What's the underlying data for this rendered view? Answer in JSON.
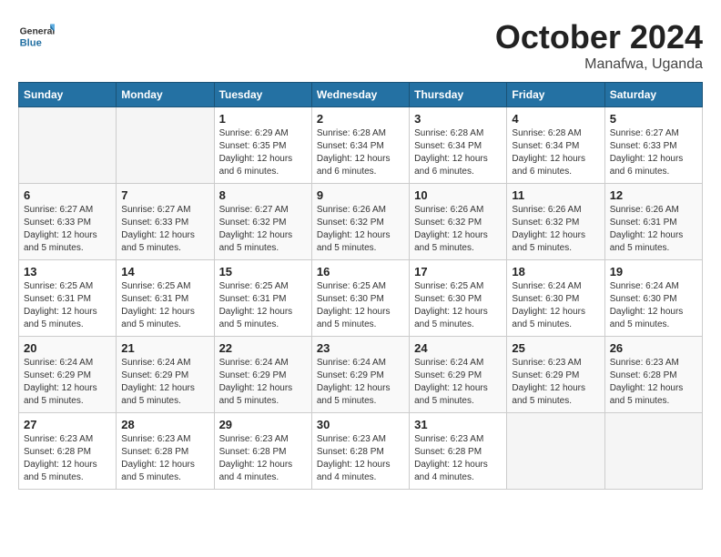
{
  "header": {
    "logo_general": "General",
    "logo_blue": "Blue",
    "month_title": "October 2024",
    "location": "Manafwa, Uganda"
  },
  "days_of_week": [
    "Sunday",
    "Monday",
    "Tuesday",
    "Wednesday",
    "Thursday",
    "Friday",
    "Saturday"
  ],
  "weeks": [
    [
      {
        "day": "",
        "info": ""
      },
      {
        "day": "",
        "info": ""
      },
      {
        "day": "1",
        "info": "Sunrise: 6:29 AM\nSunset: 6:35 PM\nDaylight: 12 hours\nand 6 minutes."
      },
      {
        "day": "2",
        "info": "Sunrise: 6:28 AM\nSunset: 6:34 PM\nDaylight: 12 hours\nand 6 minutes."
      },
      {
        "day": "3",
        "info": "Sunrise: 6:28 AM\nSunset: 6:34 PM\nDaylight: 12 hours\nand 6 minutes."
      },
      {
        "day": "4",
        "info": "Sunrise: 6:28 AM\nSunset: 6:34 PM\nDaylight: 12 hours\nand 6 minutes."
      },
      {
        "day": "5",
        "info": "Sunrise: 6:27 AM\nSunset: 6:33 PM\nDaylight: 12 hours\nand 6 minutes."
      }
    ],
    [
      {
        "day": "6",
        "info": "Sunrise: 6:27 AM\nSunset: 6:33 PM\nDaylight: 12 hours\nand 5 minutes."
      },
      {
        "day": "7",
        "info": "Sunrise: 6:27 AM\nSunset: 6:33 PM\nDaylight: 12 hours\nand 5 minutes."
      },
      {
        "day": "8",
        "info": "Sunrise: 6:27 AM\nSunset: 6:32 PM\nDaylight: 12 hours\nand 5 minutes."
      },
      {
        "day": "9",
        "info": "Sunrise: 6:26 AM\nSunset: 6:32 PM\nDaylight: 12 hours\nand 5 minutes."
      },
      {
        "day": "10",
        "info": "Sunrise: 6:26 AM\nSunset: 6:32 PM\nDaylight: 12 hours\nand 5 minutes."
      },
      {
        "day": "11",
        "info": "Sunrise: 6:26 AM\nSunset: 6:32 PM\nDaylight: 12 hours\nand 5 minutes."
      },
      {
        "day": "12",
        "info": "Sunrise: 6:26 AM\nSunset: 6:31 PM\nDaylight: 12 hours\nand 5 minutes."
      }
    ],
    [
      {
        "day": "13",
        "info": "Sunrise: 6:25 AM\nSunset: 6:31 PM\nDaylight: 12 hours\nand 5 minutes."
      },
      {
        "day": "14",
        "info": "Sunrise: 6:25 AM\nSunset: 6:31 PM\nDaylight: 12 hours\nand 5 minutes."
      },
      {
        "day": "15",
        "info": "Sunrise: 6:25 AM\nSunset: 6:31 PM\nDaylight: 12 hours\nand 5 minutes."
      },
      {
        "day": "16",
        "info": "Sunrise: 6:25 AM\nSunset: 6:30 PM\nDaylight: 12 hours\nand 5 minutes."
      },
      {
        "day": "17",
        "info": "Sunrise: 6:25 AM\nSunset: 6:30 PM\nDaylight: 12 hours\nand 5 minutes."
      },
      {
        "day": "18",
        "info": "Sunrise: 6:24 AM\nSunset: 6:30 PM\nDaylight: 12 hours\nand 5 minutes."
      },
      {
        "day": "19",
        "info": "Sunrise: 6:24 AM\nSunset: 6:30 PM\nDaylight: 12 hours\nand 5 minutes."
      }
    ],
    [
      {
        "day": "20",
        "info": "Sunrise: 6:24 AM\nSunset: 6:29 PM\nDaylight: 12 hours\nand 5 minutes."
      },
      {
        "day": "21",
        "info": "Sunrise: 6:24 AM\nSunset: 6:29 PM\nDaylight: 12 hours\nand 5 minutes."
      },
      {
        "day": "22",
        "info": "Sunrise: 6:24 AM\nSunset: 6:29 PM\nDaylight: 12 hours\nand 5 minutes."
      },
      {
        "day": "23",
        "info": "Sunrise: 6:24 AM\nSunset: 6:29 PM\nDaylight: 12 hours\nand 5 minutes."
      },
      {
        "day": "24",
        "info": "Sunrise: 6:24 AM\nSunset: 6:29 PM\nDaylight: 12 hours\nand 5 minutes."
      },
      {
        "day": "25",
        "info": "Sunrise: 6:23 AM\nSunset: 6:29 PM\nDaylight: 12 hours\nand 5 minutes."
      },
      {
        "day": "26",
        "info": "Sunrise: 6:23 AM\nSunset: 6:28 PM\nDaylight: 12 hours\nand 5 minutes."
      }
    ],
    [
      {
        "day": "27",
        "info": "Sunrise: 6:23 AM\nSunset: 6:28 PM\nDaylight: 12 hours\nand 5 minutes."
      },
      {
        "day": "28",
        "info": "Sunrise: 6:23 AM\nSunset: 6:28 PM\nDaylight: 12 hours\nand 5 minutes."
      },
      {
        "day": "29",
        "info": "Sunrise: 6:23 AM\nSunset: 6:28 PM\nDaylight: 12 hours\nand 4 minutes."
      },
      {
        "day": "30",
        "info": "Sunrise: 6:23 AM\nSunset: 6:28 PM\nDaylight: 12 hours\nand 4 minutes."
      },
      {
        "day": "31",
        "info": "Sunrise: 6:23 AM\nSunset: 6:28 PM\nDaylight: 12 hours\nand 4 minutes."
      },
      {
        "day": "",
        "info": ""
      },
      {
        "day": "",
        "info": ""
      }
    ]
  ]
}
